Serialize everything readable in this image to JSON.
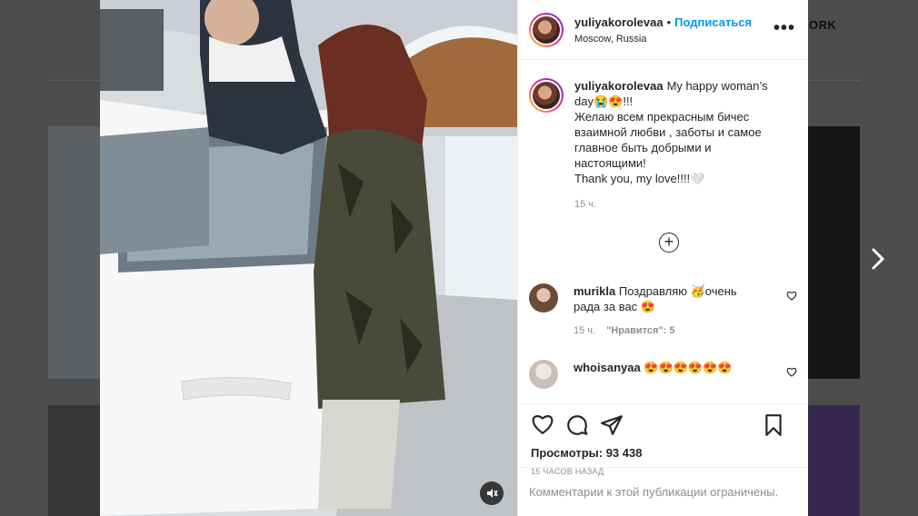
{
  "background": {
    "top_label": "ORK"
  },
  "post": {
    "username": "yuliyakorolevaa",
    "follow_label": "Подписаться",
    "separator": "•",
    "location": "Moscow, Russia",
    "more_label": "•••",
    "caption_lines": [
      "My happy woman’s",
      "day😭😍!!!",
      "Желаю всем прекрасным бичес",
      "взаимной любви , заботы и самое",
      "главное быть добрыми и",
      "настоящими!",
      "Thank you, my love!!!!🤍"
    ],
    "caption_time": "15 ч.",
    "add_comment_glyph": "+"
  },
  "comments": [
    {
      "username": "murikla",
      "text_line1": "Поздравляю 🥳очень",
      "text_line2": "рада за вас 😍",
      "time": "15 ч.",
      "likes": "\"Нравится\": 5"
    },
    {
      "username": "whoisanyaa",
      "text_line1": "😍😍😍😍😍😍"
    }
  ],
  "actions": {
    "views": "Просмотры: 93 438",
    "posted_ago": "15 ЧАСОВ НАЗАД"
  },
  "footer": {
    "comments_disabled": "Комментарии к этой публикации ограничены."
  },
  "icons": {
    "like": "heart-icon",
    "comment": "comment-icon",
    "share": "share-icon",
    "save": "bookmark-icon",
    "mute": "mute-icon",
    "next": "chevron-right-icon"
  },
  "colors": {
    "link": "#0095f6",
    "meta": "#8e8e8e",
    "text": "#262626"
  }
}
